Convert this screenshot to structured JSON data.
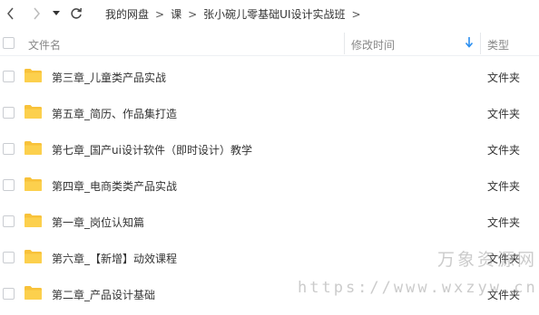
{
  "toolbar": {
    "back_icon": "chevron-left-icon",
    "forward_icon": "chevron-right-icon",
    "dropdown_icon": "caret-down-icon",
    "refresh_icon": "refresh-icon"
  },
  "breadcrumb": {
    "items": [
      "我的网盘",
      "课",
      "张小碗儿零基础UI设计实战班"
    ],
    "separator": ">"
  },
  "table": {
    "columns": {
      "name": "文件名",
      "modified": "修改时间",
      "type": "类型"
    },
    "sort_icon": "arrow-down-icon",
    "rows": [
      {
        "name": "第三章_儿童类产品实战",
        "type": "文件夹"
      },
      {
        "name": "第五章_简历、作品集打造",
        "type": "文件夹"
      },
      {
        "name": "第七章_国产ui设计软件（即时设计）教学",
        "type": "文件夹"
      },
      {
        "name": "第四章_电商类类产品实战",
        "type": "文件夹"
      },
      {
        "name": "第一章_岗位认知篇",
        "type": "文件夹"
      },
      {
        "name": "第六章_【新增】动效课程",
        "type": "文件夹"
      },
      {
        "name": "第二章_产品设计基础",
        "type": "文件夹"
      }
    ]
  },
  "watermark": {
    "title": "万象资源网",
    "url": "https://www.wxzyw.cn"
  },
  "colors": {
    "folder": "#f8c23a",
    "accent": "#2a8ef0",
    "text": "#333333",
    "header_text": "#888888"
  }
}
